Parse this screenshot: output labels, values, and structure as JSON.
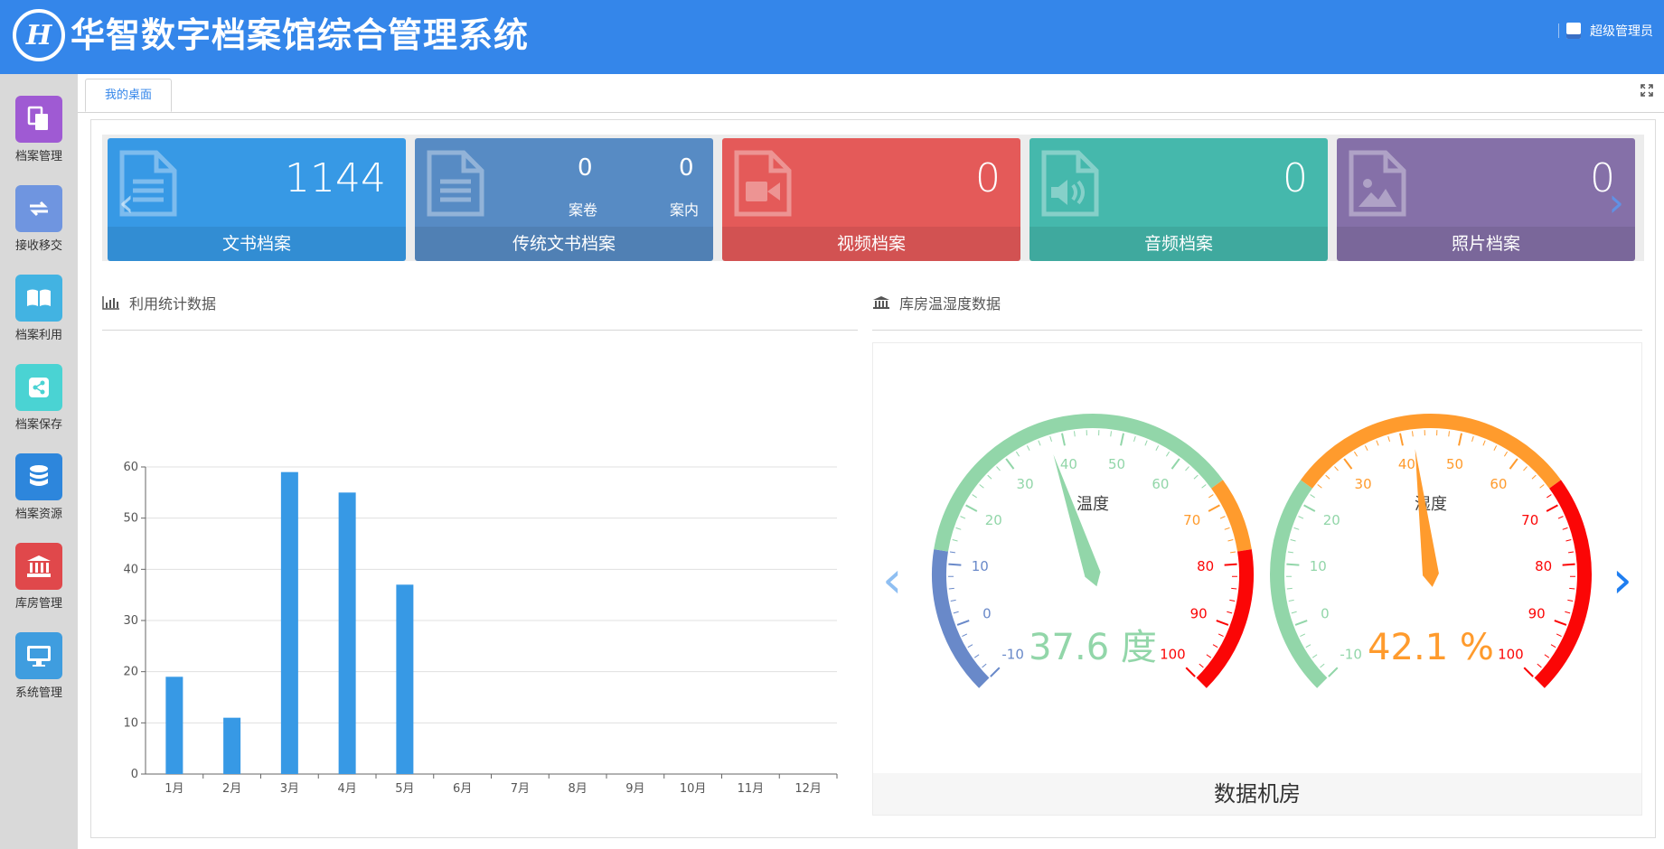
{
  "header": {
    "title": "华智数字档案馆综合管理系统",
    "logo_text": "H",
    "user_label": "超级管理员"
  },
  "sidebar": {
    "items": [
      {
        "label": "档案管理",
        "icon": "documents-icon",
        "color": "#9f5ad3"
      },
      {
        "label": "接收移交",
        "icon": "transfer-icon",
        "color": "#6f95e0"
      },
      {
        "label": "档案利用",
        "icon": "book-icon",
        "color": "#42b3e2"
      },
      {
        "label": "档案保存",
        "icon": "share-icon",
        "color": "#4ad3d3"
      },
      {
        "label": "档案资源",
        "icon": "database-icon",
        "color": "#2d86dc"
      },
      {
        "label": "库房管理",
        "icon": "institution-icon",
        "color": "#e0484b"
      },
      {
        "label": "系统管理",
        "icon": "monitor-icon",
        "color": "#3f9ddf"
      }
    ]
  },
  "tabs": {
    "active": "我的桌面"
  },
  "cards": [
    {
      "label": "文书档案",
      "value": "1144",
      "color": "#3799e5",
      "icon": "document-icon"
    },
    {
      "label": "传统文书档案",
      "v1": "0",
      "l1": "案卷",
      "v2": "0",
      "l2": "案内",
      "color": "#578bc4",
      "icon": "document-icon"
    },
    {
      "label": "视频档案",
      "value": "0",
      "color": "#e45a59",
      "icon": "video-file-icon"
    },
    {
      "label": "音频档案",
      "value": "0",
      "color": "#45b8ac",
      "icon": "audio-file-icon"
    },
    {
      "label": "照片档案",
      "value": "0",
      "color": "#8570a8",
      "icon": "image-file-icon"
    }
  ],
  "sections": {
    "usage": "利用统计数据",
    "warehouse": "库房温湿度数据"
  },
  "chart_data": {
    "type": "bar",
    "categories": [
      "1月",
      "2月",
      "3月",
      "4月",
      "5月",
      "6月",
      "7月",
      "8月",
      "9月",
      "10月",
      "11月",
      "12月"
    ],
    "values": [
      19,
      11,
      59,
      55,
      37,
      0,
      0,
      0,
      0,
      0,
      0,
      0
    ],
    "ylim": [
      0,
      60
    ],
    "yticks": [
      0,
      10,
      20,
      30,
      40,
      50,
      60
    ],
    "grid": true,
    "color": "#3799e5"
  },
  "gauges": [
    {
      "name": "温度",
      "value": 37.6,
      "unit": "度",
      "display": "37.6 度",
      "min": -10,
      "max": 100,
      "tick_labels": [
        "-10",
        "0",
        "10",
        "20",
        "30",
        "40",
        "50",
        "60",
        "70",
        "80",
        "90",
        "100"
      ],
      "bands": [
        {
          "to": 0.2,
          "color": "#6989c9"
        },
        {
          "to": 0.7,
          "color": "#92d6a9"
        },
        {
          "to": 0.8,
          "color": "#ff9b2d"
        },
        {
          "to": 1.0,
          "color": "#fb0606"
        }
      ],
      "value_color": "#92d6a9"
    },
    {
      "name": "湿度",
      "value": 42.1,
      "unit": "%",
      "display": "42.1 %",
      "min": -10,
      "max": 100,
      "tick_labels": [
        "-10",
        "0",
        "10",
        "20",
        "30",
        "40",
        "50",
        "60",
        "70",
        "80",
        "90",
        "100"
      ],
      "bands": [
        {
          "to": 0.3,
          "color": "#92d6a9"
        },
        {
          "to": 0.7,
          "color": "#ff9b2d"
        },
        {
          "to": 1.0,
          "color": "#fb0606"
        }
      ],
      "value_color": "#ff9b2d"
    }
  ],
  "room": {
    "label": "数据机房"
  }
}
